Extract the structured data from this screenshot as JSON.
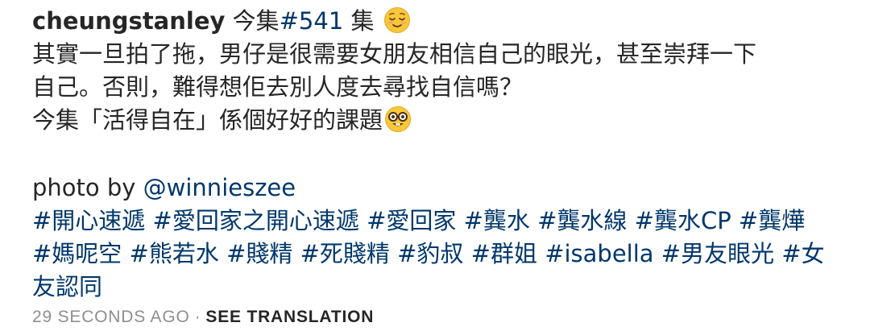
{
  "caption": {
    "username": "cheungstanley",
    "line1_text": " 今集",
    "line1_tag": "#541",
    "line1_suffix": " 集 ",
    "line2": "其實一旦拍了拖，男仔是很需要女朋友相信自己的眼光，甚至崇拜一下",
    "line3": "自己。否則，難得想佢去別人度去尋找自信嗎？",
    "line4": "今集「活得自在」係個好好的課題",
    "photo_by_text": "photo by ",
    "photo_by_handle": "@winnieszee",
    "hashtags_row1": [
      "#開心速遞",
      "#愛回家之開心速遞",
      "#愛回家",
      "#龔水",
      "#龔水線",
      "#龔水CP",
      "#龔燁"
    ],
    "hashtags_row2": [
      "#媽呢空",
      "#熊若水",
      "#賤精",
      "#死賤精",
      "#豹叔",
      "#群姐",
      "#isabella",
      "#男友眼光",
      "#女"
    ],
    "hashtags_row3": [
      "友認同"
    ],
    "emojis": [
      "relieved-face-emoji",
      "nerd-face-emoji"
    ]
  },
  "footer": {
    "timestamp": "29 SECONDS AGO",
    "separator": "·",
    "see_translation": "SEE TRANSLATION"
  },
  "colors": {
    "text": "#262626",
    "link": "#00376b",
    "muted": "#8e8e8e"
  }
}
